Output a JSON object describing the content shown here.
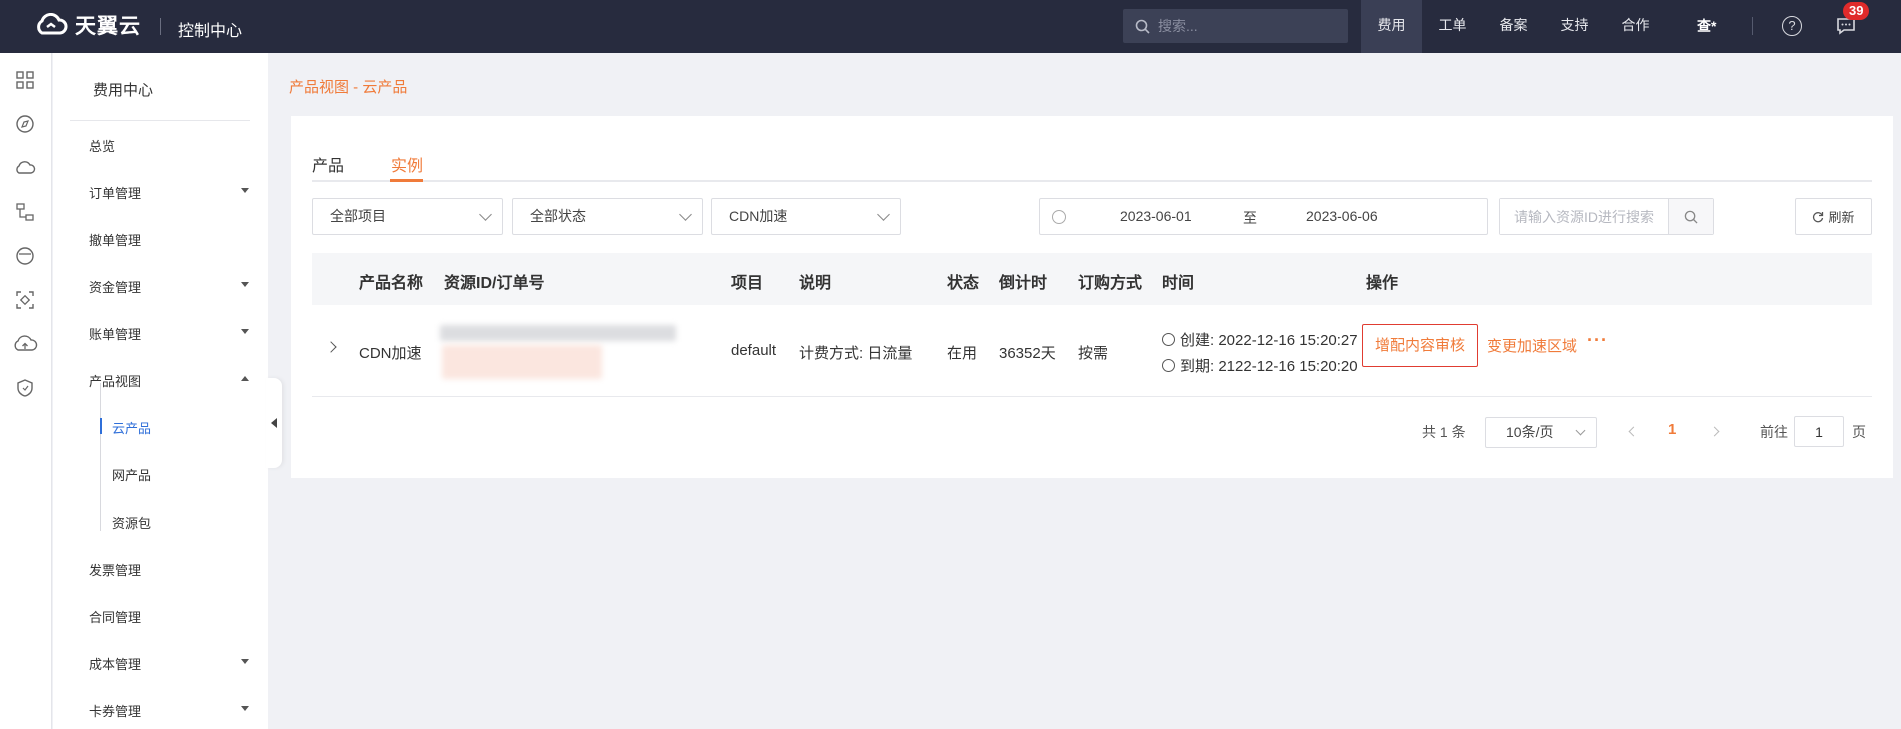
{
  "header": {
    "logo_text": "天翼云",
    "console_title": "控制中心",
    "search_placeholder": "搜索...",
    "nav": [
      "费用",
      "工单",
      "备案",
      "支持",
      "合作"
    ],
    "query_label": "查*",
    "help_label": "?",
    "message_count": "39"
  },
  "sidebar": {
    "title": "费用中心",
    "items": {
      "overview": "总览",
      "orders": "订单管理",
      "cancel": "撤单管理",
      "funds": "资金管理",
      "bills": "账单管理",
      "product_view": "产品视图",
      "invoice": "发票管理",
      "contract": "合同管理",
      "cost": "成本管理",
      "coupon": "卡券管理"
    },
    "sub_items": {
      "cloud": "云产品",
      "network": "网产品",
      "package": "资源包"
    }
  },
  "main": {
    "breadcrumb": "产品视图 - 云产品",
    "tabs": {
      "product": "产品",
      "instance": "实例"
    },
    "filters": {
      "project": "全部项目",
      "status": "全部状态",
      "product": "CDN加速",
      "date_start": "2023-06-01",
      "date_sep": "至",
      "date_end": "2023-06-06",
      "search_placeholder": "请输入资源ID进行搜索",
      "refresh": "刷新"
    },
    "table": {
      "headers": {
        "name": "产品名称",
        "resource": "资源ID/订单号",
        "project": "项目",
        "desc": "说明",
        "status": "状态",
        "countdown": "倒计时",
        "purchase": "订购方式",
        "time": "时间",
        "ops": "操作"
      },
      "row": {
        "name": "CDN加速",
        "project": "default",
        "desc": "计费方式:  日流量",
        "status": "在用",
        "countdown": "36352天",
        "purchase": "按需",
        "created": "创建:  2022-12-16 15:20:27",
        "expires": "到期:  2122-12-16 15:20:20",
        "op_primary": "增配内容审核",
        "op_secondary": "变更加速区域",
        "op_more": "···"
      }
    },
    "pagination": {
      "total": "共 1 条",
      "page_size": "10条/页",
      "current": "1",
      "goto_label": "前往",
      "goto_value": "1",
      "page_suffix": "页"
    }
  },
  "colors": {
    "topbar": "#272b3e",
    "accent": "#f07b3a",
    "sidebar_active": "#2f6fd9",
    "badge": "#e02b2b"
  }
}
